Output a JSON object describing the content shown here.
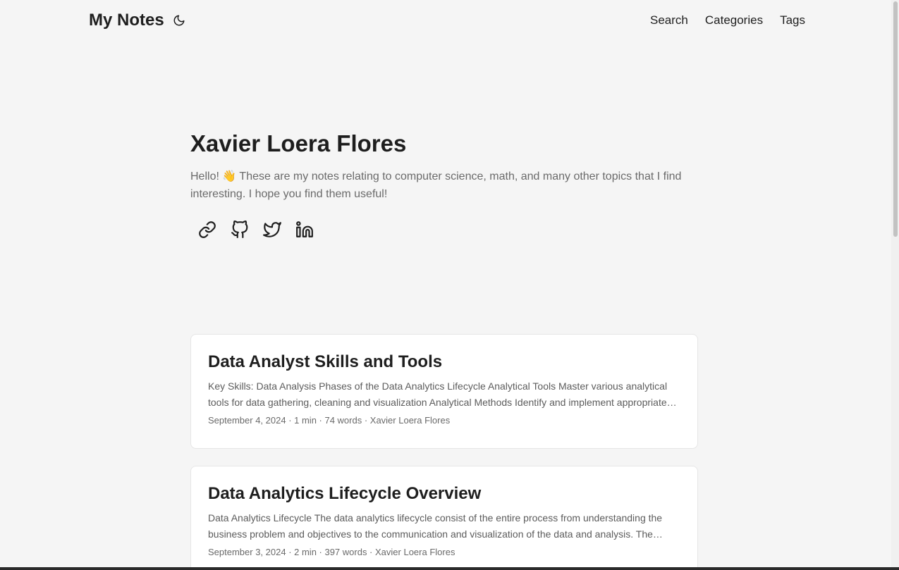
{
  "header": {
    "logo": "My Notes",
    "nav": [
      "Search",
      "Categories",
      "Tags"
    ]
  },
  "profile": {
    "name": "Xavier Loera Flores",
    "bio": "Hello! 👋 These are my notes relating to computer science, math, and many other topics that I find interesting. I hope you find them useful!",
    "socials": [
      "link-icon",
      "github-icon",
      "twitter-icon",
      "linkedin-icon"
    ]
  },
  "posts": [
    {
      "title": "Data Analyst Skills and Tools",
      "summary": "Key Skills: Data Analysis Phases of the Data Analytics Lifecycle Analytical Tools Master various analytical tools for data gathering, cleaning and visualization Analytical Methods Identify and implement appropriate analytical methods",
      "meta": "September 4, 2024 · 1 min · 74 words · Xavier Loera Flores"
    },
    {
      "title": "Data Analytics Lifecycle Overview",
      "summary": "Data Analytics Lifecycle The data analytics lifecycle consist of the entire process from understanding the business problem and objectives to the communication and visualization of the data and analysis. The lifecycle consists of several phases",
      "meta": "September 3, 2024 · 2 min · 397 words · Xavier Loera Flores"
    }
  ],
  "colors": {
    "background": "#f5f5f5",
    "text": "#1e1e1e",
    "muted": "#6a6a6a",
    "card": "#ffffff"
  }
}
